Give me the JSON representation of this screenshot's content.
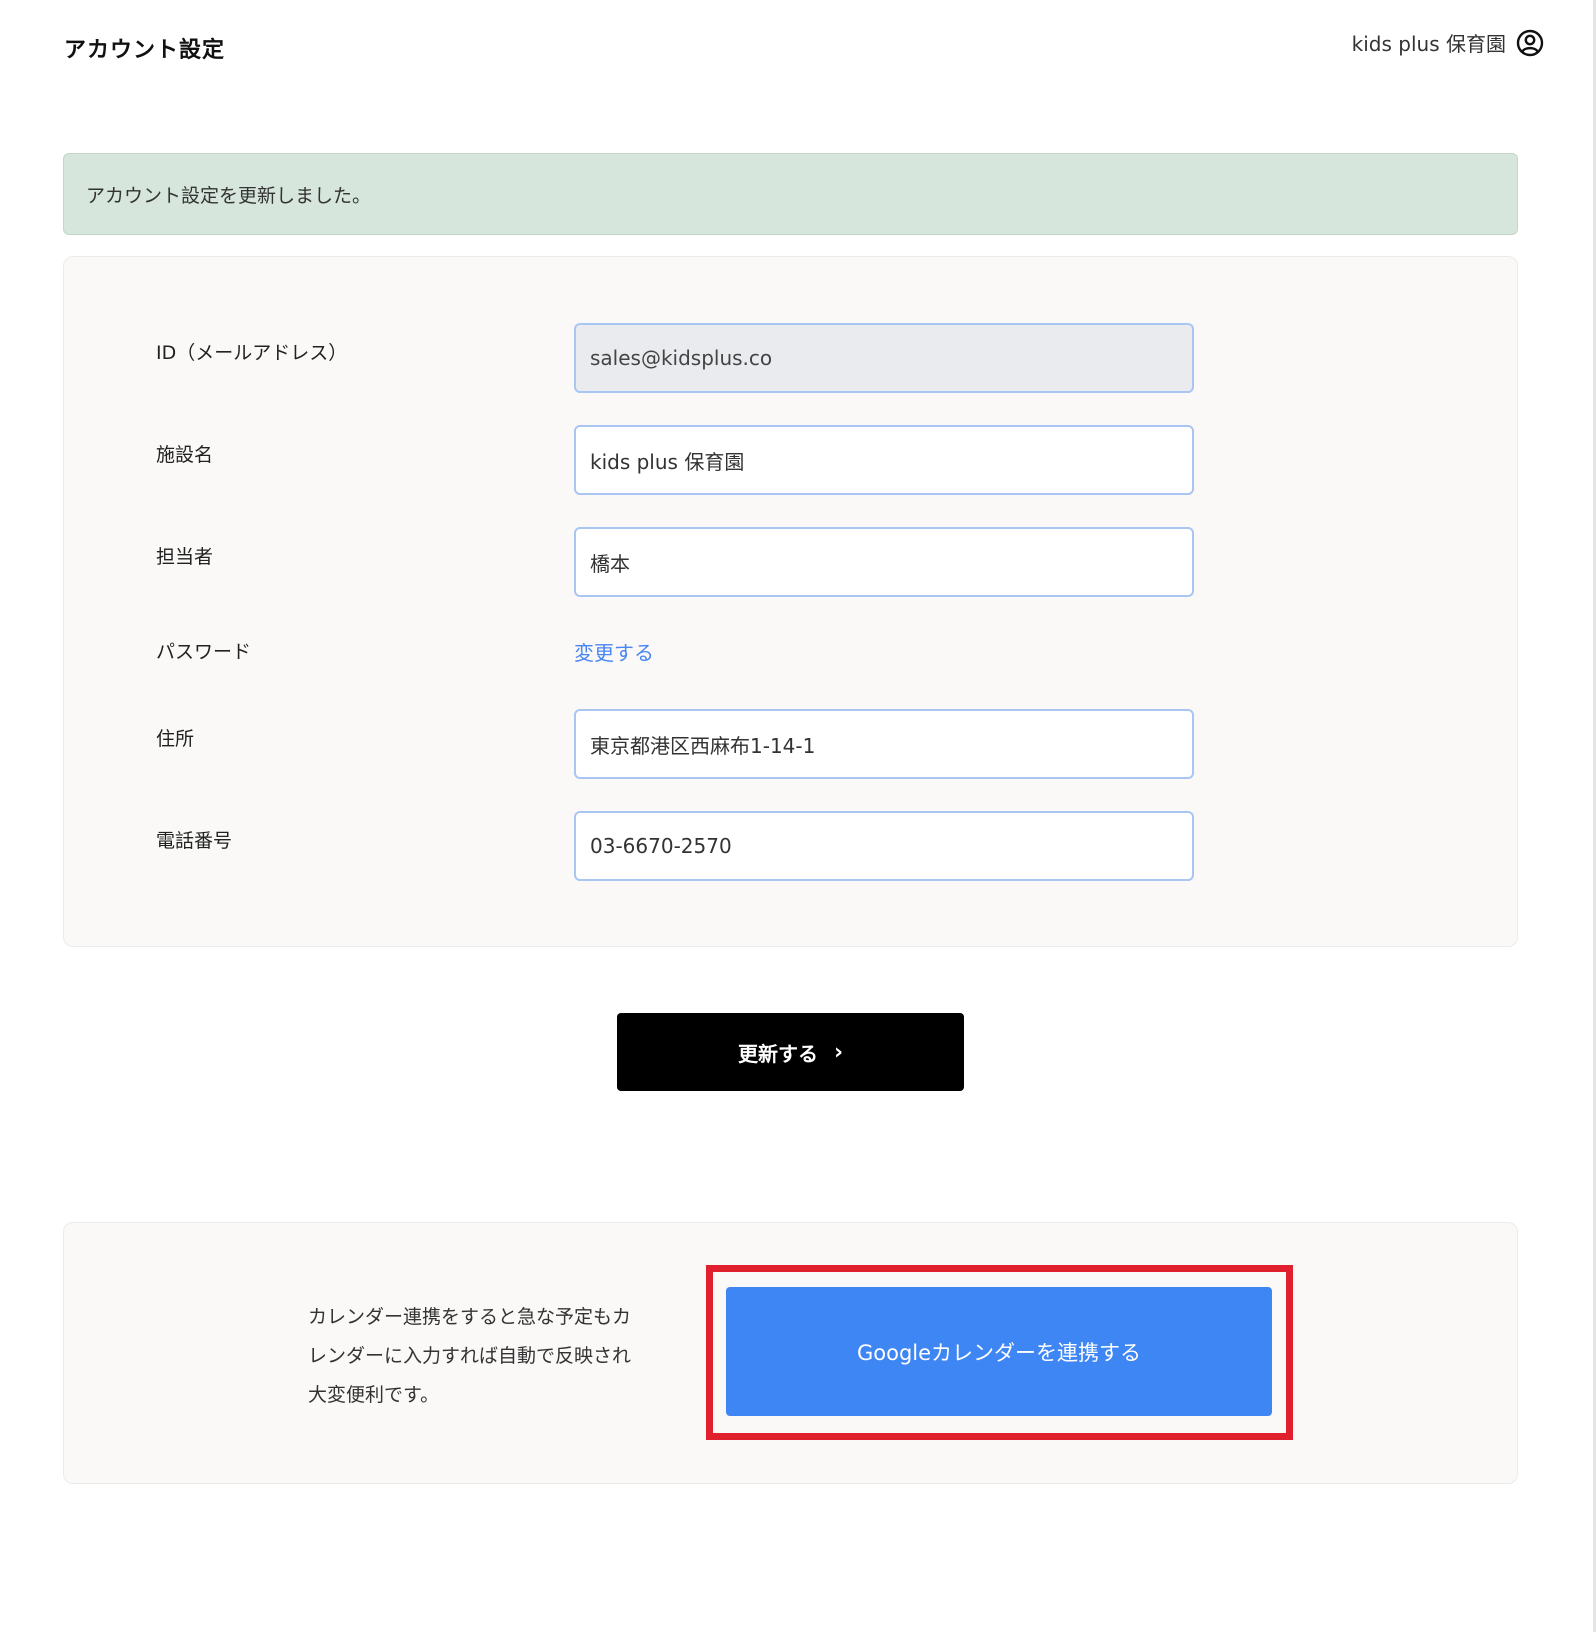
{
  "header": {
    "title": "アカウント設定",
    "user_name": "kids plus 保育園",
    "user_icon": "user-circle-icon"
  },
  "alert": {
    "message": "アカウント設定を更新しました。",
    "color": "#d6e6dd"
  },
  "form": {
    "email": {
      "label": "ID（メールアドレス）",
      "value": "sales@kidsplus.co"
    },
    "facility": {
      "label": "施設名",
      "value": "kids plus 保育園"
    },
    "manager": {
      "label": "担当者",
      "value": "橋本"
    },
    "password": {
      "label": "パスワード",
      "link_label": "変更する"
    },
    "address": {
      "label": "住所",
      "value": "東京都港区西麻布1-14-1"
    },
    "phone": {
      "label": "電話番号",
      "value": "03-6670-2570"
    }
  },
  "update_button": {
    "label": "更新する",
    "icon": "chevron-right-icon"
  },
  "calendar": {
    "description_lines": [
      "カレンダー連携をすると急な予定もカ",
      "レンダーに入力すれば自動で反映され",
      "大変便利です。"
    ],
    "button_label": "Googleカレンダーを連携する",
    "button_color": "#3f86f5",
    "highlight_color": "#e0202c"
  }
}
